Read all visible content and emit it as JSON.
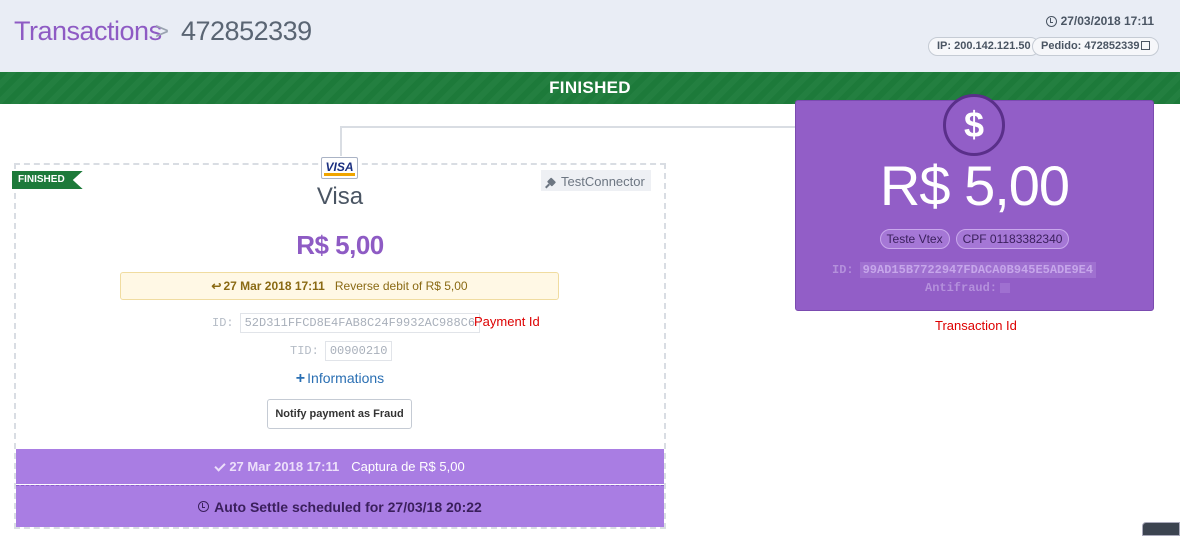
{
  "header": {
    "breadcrumb_root": "Transactions",
    "breadcrumb_sep": ">",
    "transaction_id": "472852339",
    "date": "27/03/2018 17:11",
    "ip_pill": "IP: 200.142.121.50",
    "order_pill": "Pedido: 472852339"
  },
  "status_bar": {
    "label": "FINISHED"
  },
  "payment": {
    "status_ribbon": "FINISHED",
    "card_logo_text": "VISA",
    "method_name": "Visa",
    "connector": "TestConnector",
    "amount": "R$ 5,00",
    "reverse": {
      "date": "27 Mar 2018 17:11",
      "text": "Reverse debit of R$ 5,00"
    },
    "id_label": "ID:",
    "id_value": "52D311FFCD8E4FAB8C24F9932AC988C6",
    "id_annotation": "Payment Id",
    "tid_label": "TID:",
    "tid_value": "00900210",
    "informations_link": "Informations",
    "fraud_button": "Notify payment as Fraud",
    "capture": {
      "date": "27 Mar 2018 17:11",
      "text": "Captura de R$ 5,00"
    },
    "auto_settle": "Auto Settle scheduled for 27/03/18 20:22"
  },
  "transaction": {
    "currency_symbol": "$",
    "amount": "R$ 5,00",
    "tags": [
      "Teste Vtex",
      "CPF 01183382340"
    ],
    "id_label": "ID:",
    "id_value": "99AD15B7722947FDACA0B945E5ADE9E4",
    "antifraud_label": "Antifraud:",
    "annotation": "Transaction Id"
  },
  "colors": {
    "accent_purple": "#8e5bc4",
    "status_green": "#1d7a3a",
    "transaction_card": "#925ec7",
    "annotation_red": "#dd0000"
  }
}
